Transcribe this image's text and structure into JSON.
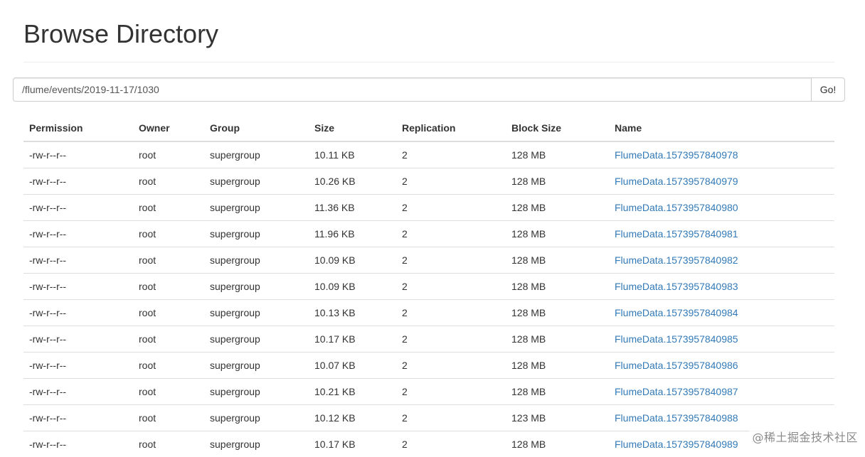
{
  "header": {
    "title": "Browse Directory"
  },
  "path_form": {
    "path_value": "/flume/events/2019-11-17/1030",
    "go_label": "Go!"
  },
  "table": {
    "columns": [
      "Permission",
      "Owner",
      "Group",
      "Size",
      "Replication",
      "Block Size",
      "Name"
    ],
    "rows": [
      {
        "permission": "-rw-r--r--",
        "owner": "root",
        "group": "supergroup",
        "size": "10.11 KB",
        "replication": "2",
        "block_size": "128 MB",
        "name": "FlumeData.1573957840978"
      },
      {
        "permission": "-rw-r--r--",
        "owner": "root",
        "group": "supergroup",
        "size": "10.26 KB",
        "replication": "2",
        "block_size": "128 MB",
        "name": "FlumeData.1573957840979"
      },
      {
        "permission": "-rw-r--r--",
        "owner": "root",
        "group": "supergroup",
        "size": "11.36 KB",
        "replication": "2",
        "block_size": "128 MB",
        "name": "FlumeData.1573957840980"
      },
      {
        "permission": "-rw-r--r--",
        "owner": "root",
        "group": "supergroup",
        "size": "11.96 KB",
        "replication": "2",
        "block_size": "128 MB",
        "name": "FlumeData.1573957840981"
      },
      {
        "permission": "-rw-r--r--",
        "owner": "root",
        "group": "supergroup",
        "size": "10.09 KB",
        "replication": "2",
        "block_size": "128 MB",
        "name": "FlumeData.1573957840982"
      },
      {
        "permission": "-rw-r--r--",
        "owner": "root",
        "group": "supergroup",
        "size": "10.09 KB",
        "replication": "2",
        "block_size": "128 MB",
        "name": "FlumeData.1573957840983"
      },
      {
        "permission": "-rw-r--r--",
        "owner": "root",
        "group": "supergroup",
        "size": "10.13 KB",
        "replication": "2",
        "block_size": "128 MB",
        "name": "FlumeData.1573957840984"
      },
      {
        "permission": "-rw-r--r--",
        "owner": "root",
        "group": "supergroup",
        "size": "10.17 KB",
        "replication": "2",
        "block_size": "128 MB",
        "name": "FlumeData.1573957840985"
      },
      {
        "permission": "-rw-r--r--",
        "owner": "root",
        "group": "supergroup",
        "size": "10.07 KB",
        "replication": "2",
        "block_size": "128 MB",
        "name": "FlumeData.1573957840986"
      },
      {
        "permission": "-rw-r--r--",
        "owner": "root",
        "group": "supergroup",
        "size": "10.21 KB",
        "replication": "2",
        "block_size": "128 MB",
        "name": "FlumeData.1573957840987"
      },
      {
        "permission": "-rw-r--r--",
        "owner": "root",
        "group": "supergroup",
        "size": "10.12 KB",
        "replication": "2",
        "block_size": "123 MB",
        "name": "FlumeData.1573957840988"
      },
      {
        "permission": "-rw-r--r--",
        "owner": "root",
        "group": "supergroup",
        "size": "10.17 KB",
        "replication": "2",
        "block_size": "128 MB",
        "name": "FlumeData.1573957840989"
      }
    ]
  },
  "watermark": {
    "text": "@稀土掘金技术社区"
  },
  "colors": {
    "link": "#337ab7",
    "text": "#333333",
    "border": "#dddddd"
  }
}
